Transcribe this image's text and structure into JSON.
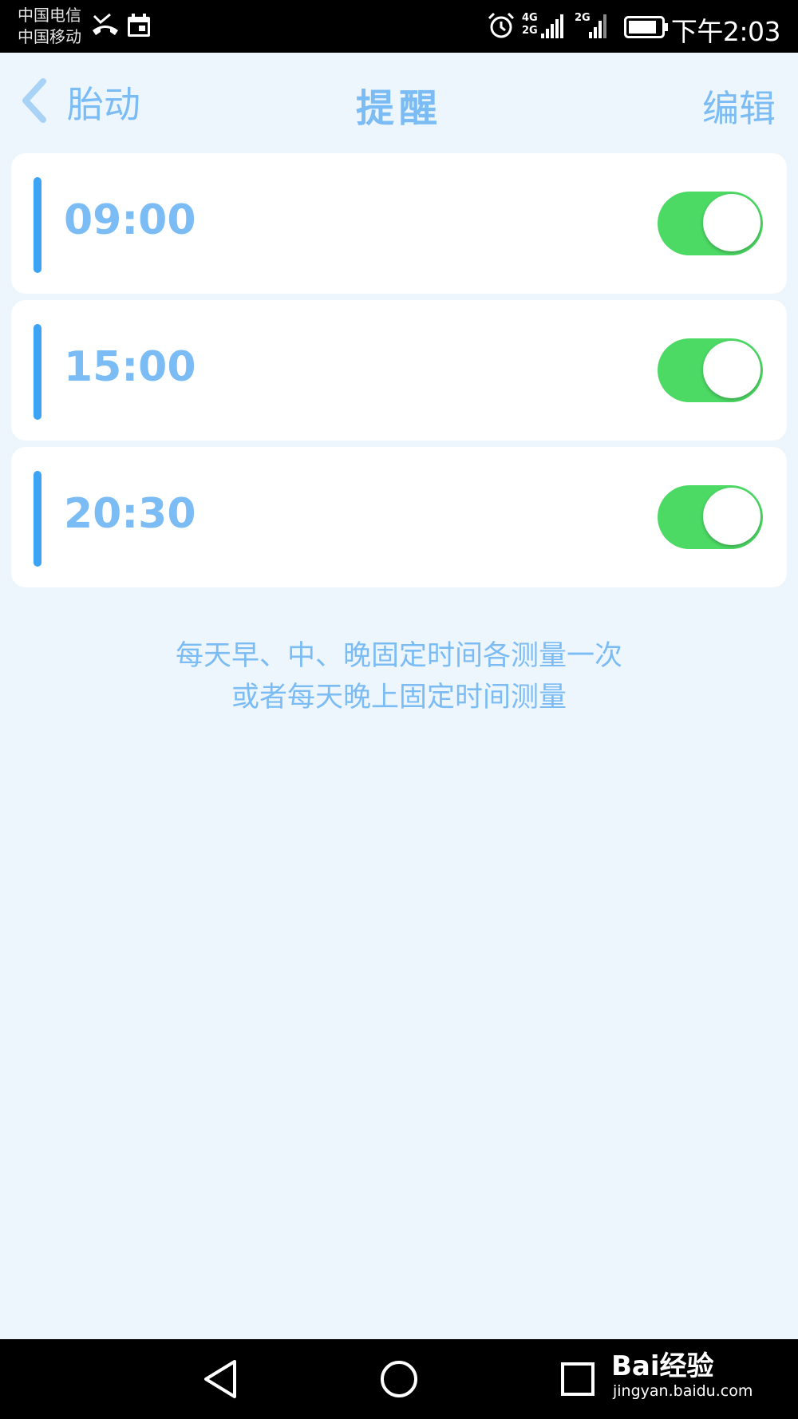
{
  "status_bar": {
    "carrier_1": "中国电信",
    "carrier_2": "中国移动",
    "net_1": "4G",
    "net_1b": "2G",
    "net_2": "2G",
    "time": "下午2:03"
  },
  "nav": {
    "back_label": "胎动",
    "title": "提醒",
    "edit_label": "编辑"
  },
  "reminders": [
    {
      "time": "09:00",
      "enabled": true
    },
    {
      "time": "15:00",
      "enabled": true
    },
    {
      "time": "20:30",
      "enabled": true
    }
  ],
  "hint": {
    "line_1": "每天早、中、晚固定时间各测量一次",
    "line_2": "或者每天晚上固定时间测量"
  },
  "watermark": {
    "brand": "Bai经验",
    "url": "jingyan.baidu.com"
  },
  "colors": {
    "accent_blue": "#3ca3f5",
    "text_blue": "#7cbcf4",
    "toggle_on": "#4cd964",
    "background": "#eef6fd"
  }
}
